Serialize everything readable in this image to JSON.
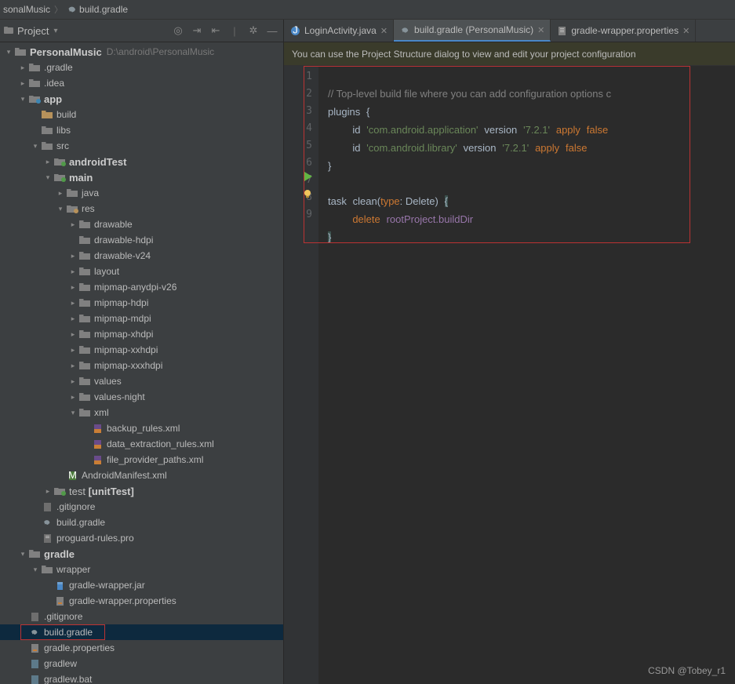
{
  "breadcrumb": {
    "root": "sonalMusic",
    "sep": "〉",
    "file": "build.gradle"
  },
  "toolbar": {
    "project_label": "Project"
  },
  "tabs": [
    {
      "label": "LoginActivity.java",
      "type": "java"
    },
    {
      "label": "build.gradle (PersonalMusic)",
      "type": "gradle",
      "active": true
    },
    {
      "label": "gradle-wrapper.properties",
      "type": "prop"
    }
  ],
  "banner": "You can use the Project Structure dialog to view and edit your project configuration",
  "watermark": "CSDN @Tobey_r1",
  "tree": {
    "root_name": "PersonalMusic",
    "root_path": "D:\\android\\PersonalMusic",
    "items": [
      {
        "d": 1,
        "a": "r",
        "k": "fg",
        "n": ".gradle"
      },
      {
        "d": 1,
        "a": "r",
        "k": "fg",
        "n": ".idea"
      },
      {
        "d": 1,
        "a": "d",
        "k": "mod",
        "n": "app"
      },
      {
        "d": 2,
        "a": "",
        "k": "fy",
        "n": "build"
      },
      {
        "d": 2,
        "a": "",
        "k": "fg",
        "n": "libs"
      },
      {
        "d": 2,
        "a": "d",
        "k": "fg",
        "n": "src"
      },
      {
        "d": 3,
        "a": "r",
        "k": "fs",
        "n": "androidTest"
      },
      {
        "d": 3,
        "a": "d",
        "k": "fs",
        "n": "main"
      },
      {
        "d": 4,
        "a": "r",
        "k": "fg",
        "n": "java"
      },
      {
        "d": 4,
        "a": "d",
        "k": "fr",
        "n": "res"
      },
      {
        "d": 5,
        "a": "r",
        "k": "fg",
        "n": "drawable"
      },
      {
        "d": 5,
        "a": "",
        "k": "fg",
        "n": "drawable-hdpi"
      },
      {
        "d": 5,
        "a": "r",
        "k": "fg",
        "n": "drawable-v24"
      },
      {
        "d": 5,
        "a": "r",
        "k": "fg",
        "n": "layout"
      },
      {
        "d": 5,
        "a": "r",
        "k": "fg",
        "n": "mipmap-anydpi-v26"
      },
      {
        "d": 5,
        "a": "r",
        "k": "fg",
        "n": "mipmap-hdpi"
      },
      {
        "d": 5,
        "a": "r",
        "k": "fg",
        "n": "mipmap-mdpi"
      },
      {
        "d": 5,
        "a": "r",
        "k": "fg",
        "n": "mipmap-xhdpi"
      },
      {
        "d": 5,
        "a": "r",
        "k": "fg",
        "n": "mipmap-xxhdpi"
      },
      {
        "d": 5,
        "a": "r",
        "k": "fg",
        "n": "mipmap-xxxhdpi"
      },
      {
        "d": 5,
        "a": "r",
        "k": "fg",
        "n": "values"
      },
      {
        "d": 5,
        "a": "r",
        "k": "fg",
        "n": "values-night"
      },
      {
        "d": 5,
        "a": "d",
        "k": "fg",
        "n": "xml"
      },
      {
        "d": 6,
        "a": "",
        "k": "xml",
        "n": "backup_rules.xml"
      },
      {
        "d": 6,
        "a": "",
        "k": "xml",
        "n": "data_extraction_rules.xml"
      },
      {
        "d": 6,
        "a": "",
        "k": "xml",
        "n": "file_provider_paths.xml"
      },
      {
        "d": 4,
        "a": "",
        "k": "xmm",
        "n": "AndroidManifest.xml"
      },
      {
        "d": 3,
        "a": "r",
        "k": "fs",
        "n": "test [unitTest]"
      },
      {
        "d": 2,
        "a": "",
        "k": "gi",
        "n": ".gitignore"
      },
      {
        "d": 2,
        "a": "",
        "k": "gr",
        "n": "build.gradle"
      },
      {
        "d": 2,
        "a": "",
        "k": "f",
        "n": "proguard-rules.pro"
      },
      {
        "d": 1,
        "a": "d",
        "k": "fg",
        "n": "gradle"
      },
      {
        "d": 2,
        "a": "d",
        "k": "fg",
        "n": "wrapper"
      },
      {
        "d": 3,
        "a": "",
        "k": "jar",
        "n": "gradle-wrapper.jar"
      },
      {
        "d": 3,
        "a": "",
        "k": "pr",
        "n": "gradle-wrapper.properties"
      },
      {
        "d": 1,
        "a": "",
        "k": "gi",
        "n": ".gitignore"
      },
      {
        "d": 1,
        "a": "",
        "k": "gr",
        "n": "build.gradle",
        "sel": true
      },
      {
        "d": 1,
        "a": "",
        "k": "pr",
        "n": "gradle.properties"
      },
      {
        "d": 1,
        "a": "",
        "k": "sh",
        "n": "gradlew"
      },
      {
        "d": 1,
        "a": "",
        "k": "sh",
        "n": "gradlew.bat"
      }
    ]
  },
  "code": {
    "lines": 9,
    "l1": "// Top-level build file where you can add configuration options c",
    "l2_plugins": "plugins",
    "l2_b": "{",
    "l3_id": "id",
    "l3_s": "'com.android.application'",
    "l3_v": "version",
    "l3_vs": "'7.2.1'",
    "l3_ap": "apply",
    "l3_f": "false",
    "l4_id": "id",
    "l4_s": "'com.android.library'",
    "l4_v": "version",
    "l4_vs": "'7.2.1'",
    "l4_ap": "apply",
    "l4_f": "false",
    "l5_b": "}",
    "l7_task": "task",
    "l7_clean": "clean",
    "l7_p1": "(",
    "l7_type": "type",
    "l7_c": ":",
    "l7_cls": " Delete",
    "l7_p2": ")",
    "l7_b": "{",
    "l8_del": "delete",
    "l8_ref": "rootProject.buildDir",
    "l9_b": "}"
  }
}
